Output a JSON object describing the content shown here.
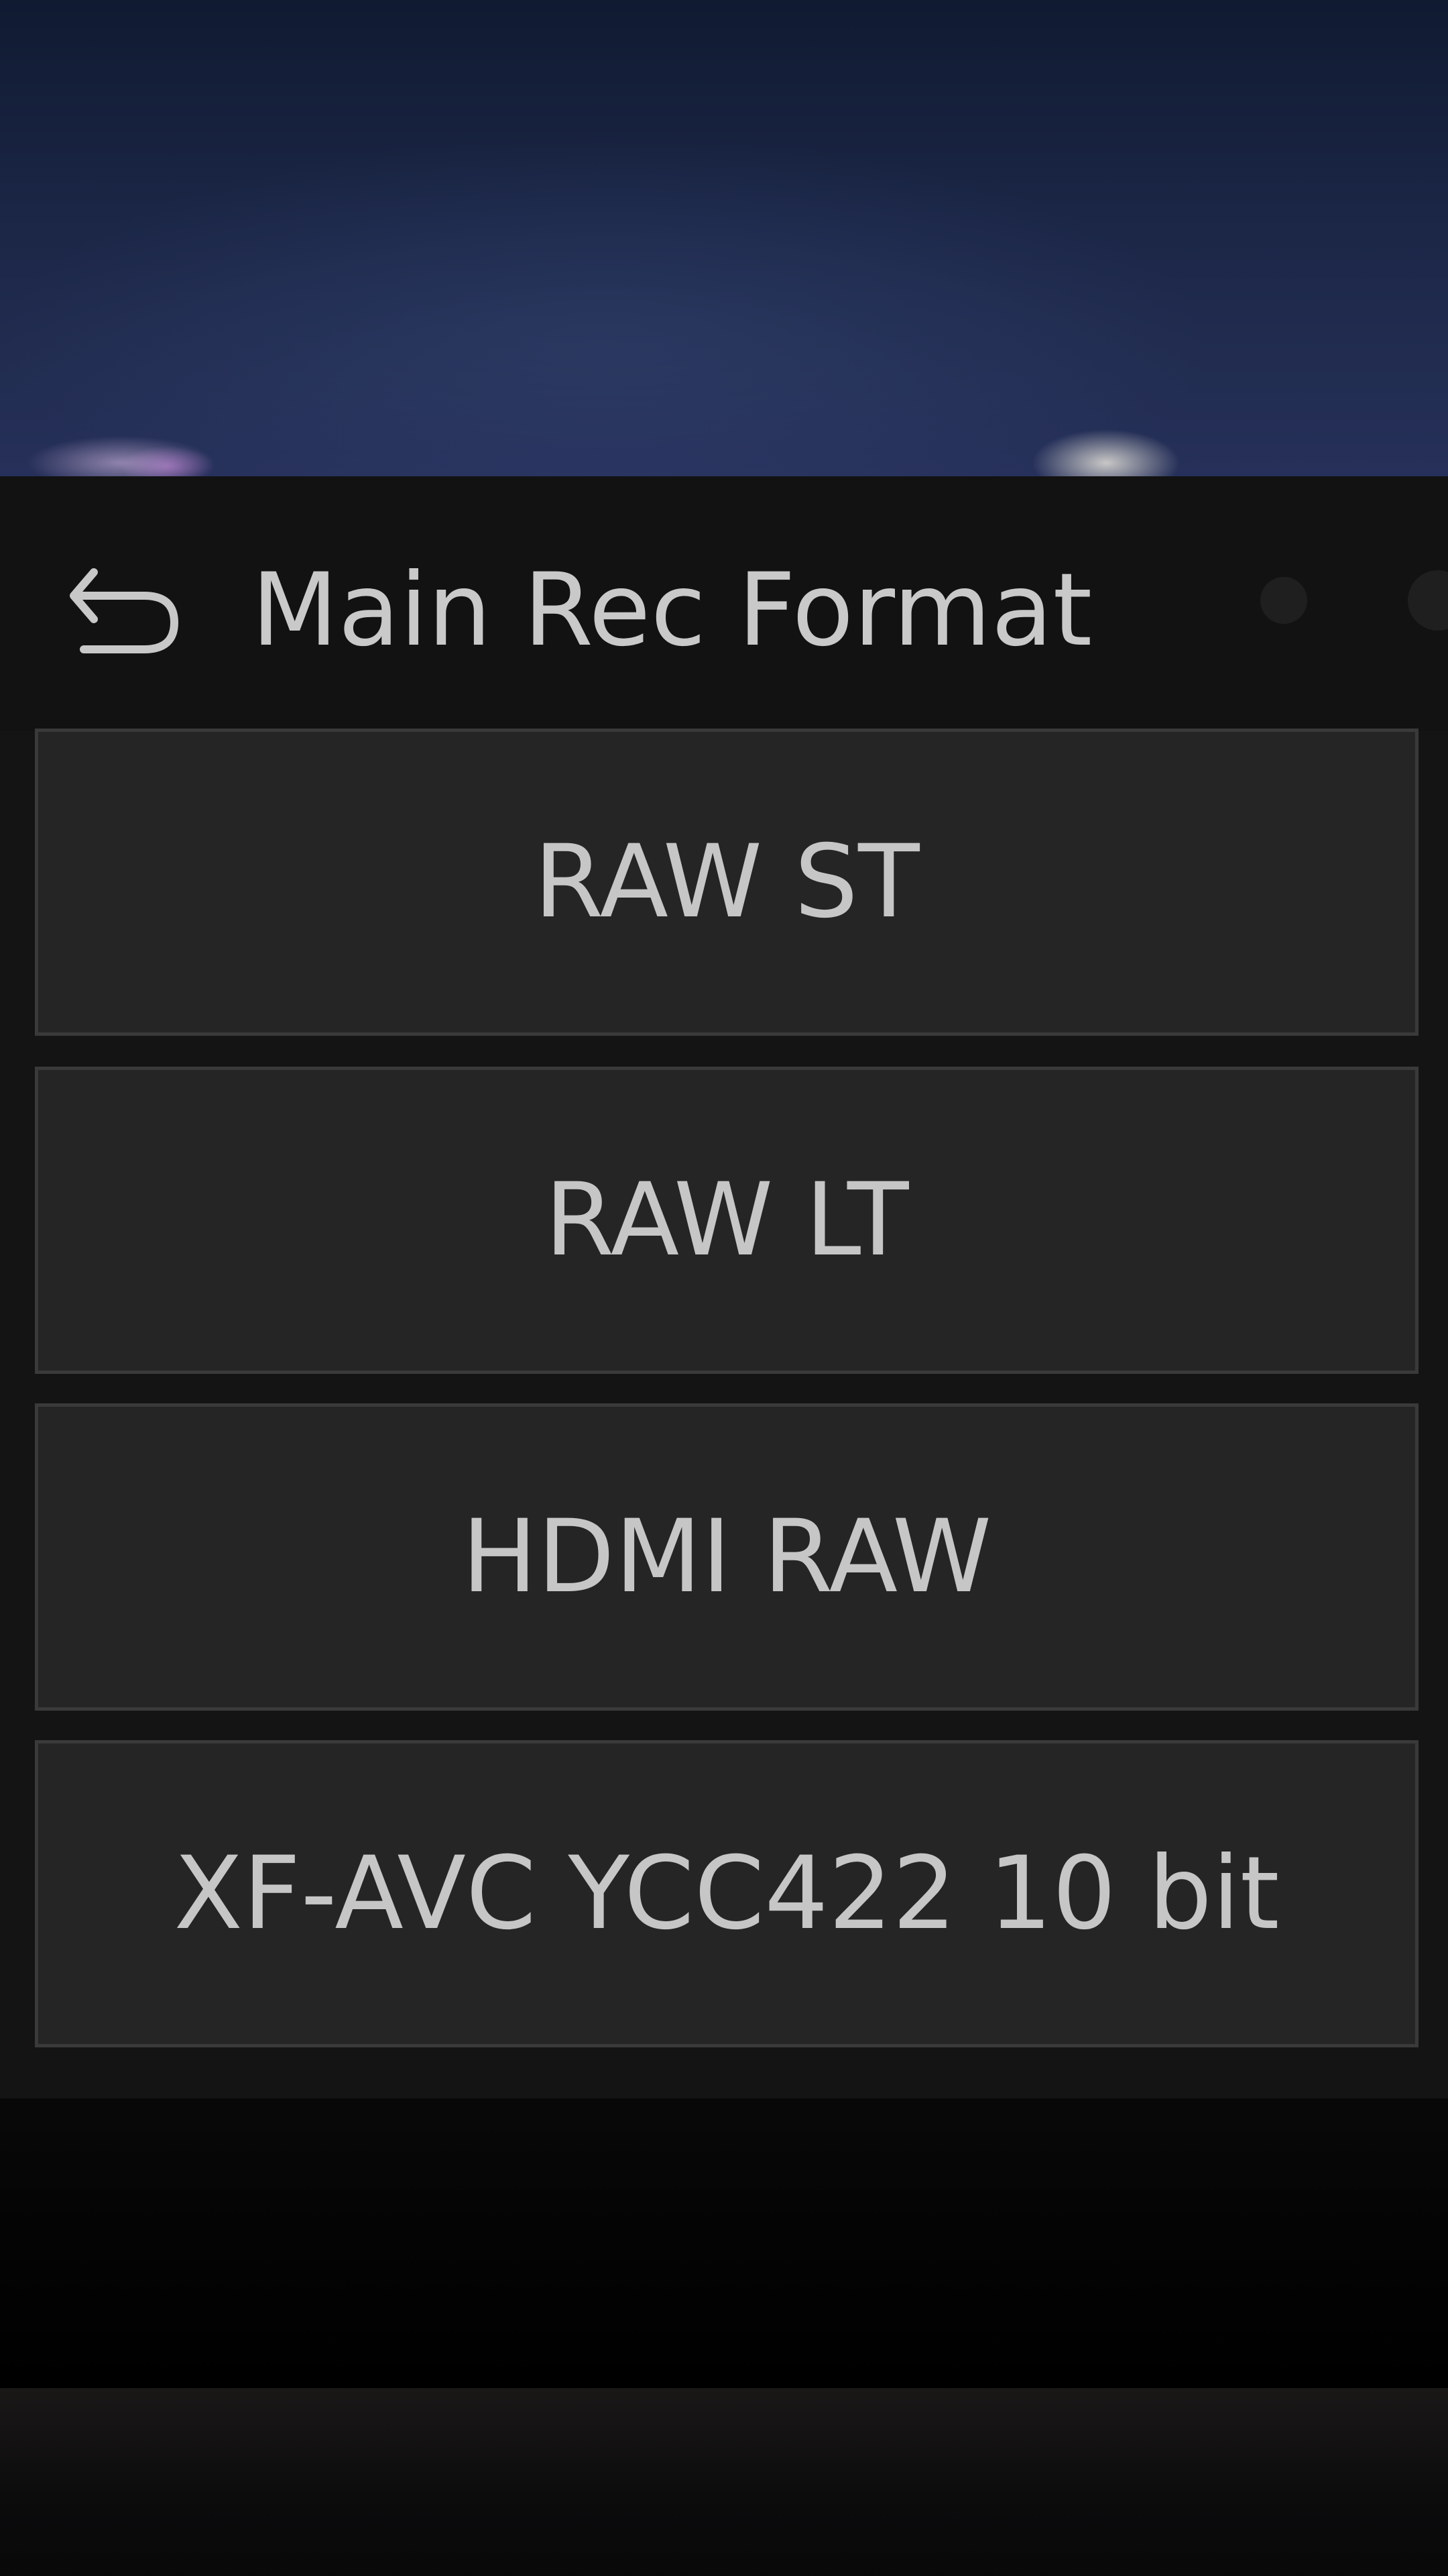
{
  "menu": {
    "title": "Main Rec Format",
    "back_icon": "back-arrow-icon",
    "options": [
      {
        "label": "RAW ST"
      },
      {
        "label": "RAW LT"
      },
      {
        "label": "HDMI RAW"
      },
      {
        "label": "XF-AVC YCC422 10 bit"
      }
    ]
  },
  "colors": {
    "panel_background": "#141414",
    "button_background": "#252525",
    "button_border": "#3a3a3a",
    "text": "#c8c8c8"
  }
}
